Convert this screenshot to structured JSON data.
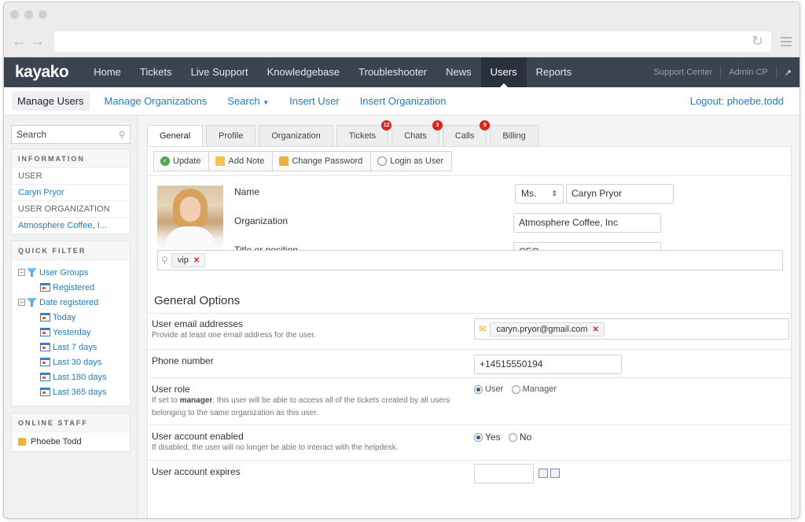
{
  "browser": {
    "back_icon": "back-arrow-icon",
    "forward_icon": "forward-arrow-icon",
    "reload_icon": "reload-icon",
    "menu_icon": "hamburger-icon"
  },
  "app": {
    "logo": "kayako",
    "nav": [
      "Home",
      "Tickets",
      "Live Support",
      "Knowledgebase",
      "Troubleshooter",
      "News",
      "Users",
      "Reports"
    ],
    "nav_active": "Users",
    "support_center": "Support Center",
    "admin_cp": "Admin CP"
  },
  "subnav": {
    "items": [
      "Manage Users",
      "Manage Organizations",
      "Search",
      "Insert User",
      "Insert Organization"
    ],
    "logout": "Logout: phoebe.todd"
  },
  "sidebar": {
    "search_placeholder": "Search",
    "information_title": "INFORMATION",
    "user_label": "USER",
    "user_value": "Caryn Pryor",
    "org_label": "USER ORGANIZATION",
    "org_value": "Atmosphere Coffee, I...",
    "quick_filter_title": "QUICK FILTER",
    "tree": {
      "user_groups": "User Groups",
      "registered": "Registered",
      "date_registered": "Date registered",
      "dates": [
        "Today",
        "Yesterday",
        "Last 7 days",
        "Last 30 days",
        "Last 180 days",
        "Last 365 days"
      ]
    },
    "online_staff_title": "ONLINE STAFF",
    "staff": [
      "Phoebe Todd"
    ]
  },
  "tabs": [
    {
      "label": "General",
      "badge": ""
    },
    {
      "label": "Profile",
      "badge": ""
    },
    {
      "label": "Organization",
      "badge": ""
    },
    {
      "label": "Tickets",
      "badge": "12"
    },
    {
      "label": "Chats",
      "badge": "3"
    },
    {
      "label": "Calls",
      "badge": "9"
    },
    {
      "label": "Billing",
      "badge": ""
    }
  ],
  "toolbar": {
    "update": "Update",
    "add_note": "Add Note",
    "change_password": "Change Password",
    "login_as_user": "Login as User"
  },
  "profile": {
    "name_label": "Name",
    "salutation": "Ms.",
    "name": "Caryn Pryor",
    "org_label": "Organization",
    "organization": "Atmosphere Coffee, Inc",
    "title_label": "Title or position",
    "title": "CEO",
    "tags": [
      "vip"
    ]
  },
  "general_options": {
    "title": "General Options",
    "email_label": "User email addresses",
    "email_desc": "Provide at least one email address for the user.",
    "email": "caryn.pryor@gmail.com",
    "phone_label": "Phone number",
    "phone": "+14515550194",
    "role_label": "User role",
    "role_desc_pre": "If set to ",
    "role_desc_bold": "manager",
    "role_desc_post": ", this user will be able to access all of the tickets created by all users belonging to the same organization as this user.",
    "role_options": [
      "User",
      "Manager"
    ],
    "role_selected": "User",
    "enabled_label": "User account enabled",
    "enabled_desc": "If disabled, the user will no longer be able to interact with the helpdesk.",
    "enabled_options": [
      "Yes",
      "No"
    ],
    "enabled_selected": "Yes",
    "expires_label": "User account expires"
  }
}
